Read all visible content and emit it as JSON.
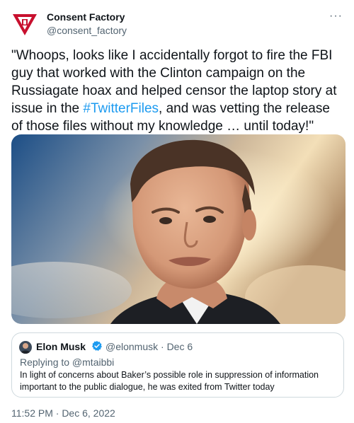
{
  "author": {
    "name": "Consent Factory",
    "handle": "@consent_factory"
  },
  "menu": {
    "more_label": "···"
  },
  "tweet": {
    "text_before": "\"Whoops, looks like I accidentally forgot to fire the FBI guy that worked with the Clinton campaign on the Russiagate hoax and helped censor the laptop story at issue in the ",
    "hashtag": "#TwitterFiles",
    "text_after": ", and was vetting the release of those files without my knowledge … until today!\""
  },
  "quote": {
    "name": "Elon Musk",
    "handle_date": "@elonmusk · Dec 6",
    "replying_to": "Replying to @mtaibbi",
    "text": "In light of concerns about Baker’s possible role in suppression of information important to the public dialogue, he was exited from Twitter today"
  },
  "timestamp": "11:52 PM · Dec 6, 2022",
  "colors": {
    "link": "#1d9bf0",
    "avatar_red": "#c8102e",
    "verified": "#1d9bf0"
  }
}
